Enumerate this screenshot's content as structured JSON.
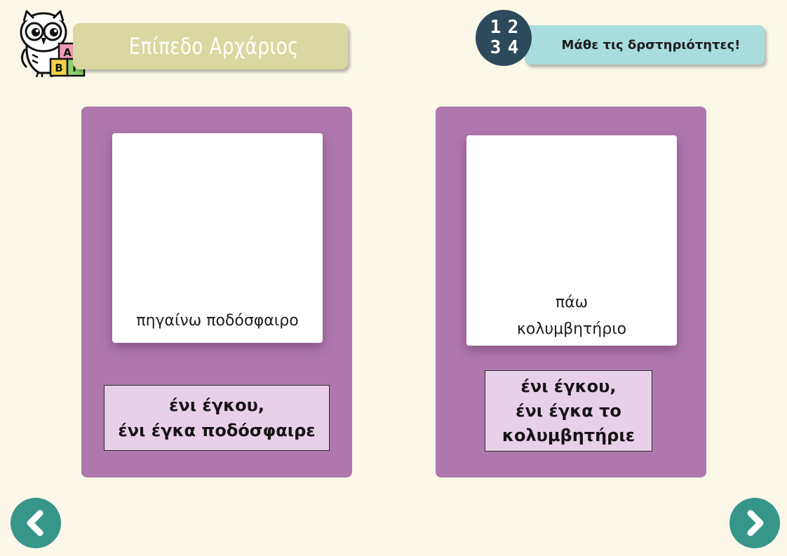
{
  "header": {
    "level_title": "Επίπεδο Αρχάριος",
    "logo_icon": "owl-with-abc-blocks-icon",
    "logo_blocks": [
      "Α",
      "Β",
      "Γ"
    ],
    "numbers_badge": [
      "1",
      "2",
      "3",
      "4"
    ],
    "learn_title": "Μάθε τις δρστηριότητες!"
  },
  "cards": [
    {
      "picture_lines": [
        "πηγαίνω ποδόσφαιρο"
      ],
      "caption_lines": [
        "ένι έγκου,",
        "ένι έγκα ποδόσφαιρε"
      ]
    },
    {
      "picture_lines": [
        "πάω",
        "κολυμβητήριο"
      ],
      "caption_lines": [
        "ένι έγκου,",
        "ένι έγκα το",
        "κολυμβητήριε"
      ]
    }
  ],
  "navigation": {
    "prev_icon": "chevron-left-icon",
    "next_icon": "chevron-right-icon"
  },
  "colors": {
    "background": "#fbf8e9",
    "card": "#ae77ae",
    "caption_box": "#e8d0e8",
    "level_banner": "#d8d8a0",
    "learn_banner": "#a9dcdc",
    "numbers_badge": "#2d4a5c",
    "nav_button": "#37968a"
  }
}
